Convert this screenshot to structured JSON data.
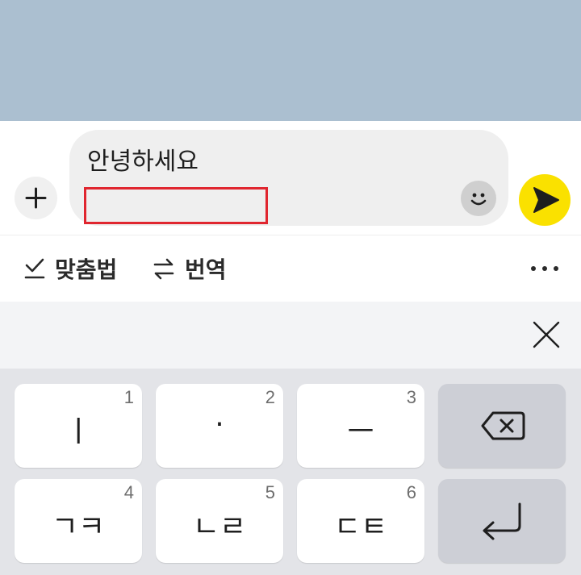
{
  "composer": {
    "message_text": "안녕하세요",
    "input_icons": {
      "plus": "plus-icon",
      "emoji": "smiley-face-icon",
      "send": "send-arrow-icon"
    }
  },
  "toolbar": {
    "spell_check_label": "맞춤법",
    "translate_label": "번역",
    "spell_check_icon": "checkmark-underline-icon",
    "translate_icon": "swap-arrows-icon",
    "more_icon": "ellipsis-icon"
  },
  "suggestion_bar": {
    "close_icon": "close-x-icon"
  },
  "keyboard": {
    "keys": [
      {
        "main": "ㅣ",
        "num": "1"
      },
      {
        "main": "·",
        "num": "2"
      },
      {
        "main": "ㅡ",
        "num": "3"
      },
      {
        "main": "ㄱㅋ",
        "num": "4"
      },
      {
        "main": "ㄴㄹ",
        "num": "5"
      },
      {
        "main": "ㄷㅌ",
        "num": "6"
      }
    ],
    "backspace_icon": "backspace-icon",
    "enter_icon": "enter-return-icon"
  },
  "colors": {
    "chat_background": "#abbfd0",
    "send_button": "#fae100",
    "highlight_box": "#e0262f",
    "keyboard_background": "#e3e4e8"
  }
}
